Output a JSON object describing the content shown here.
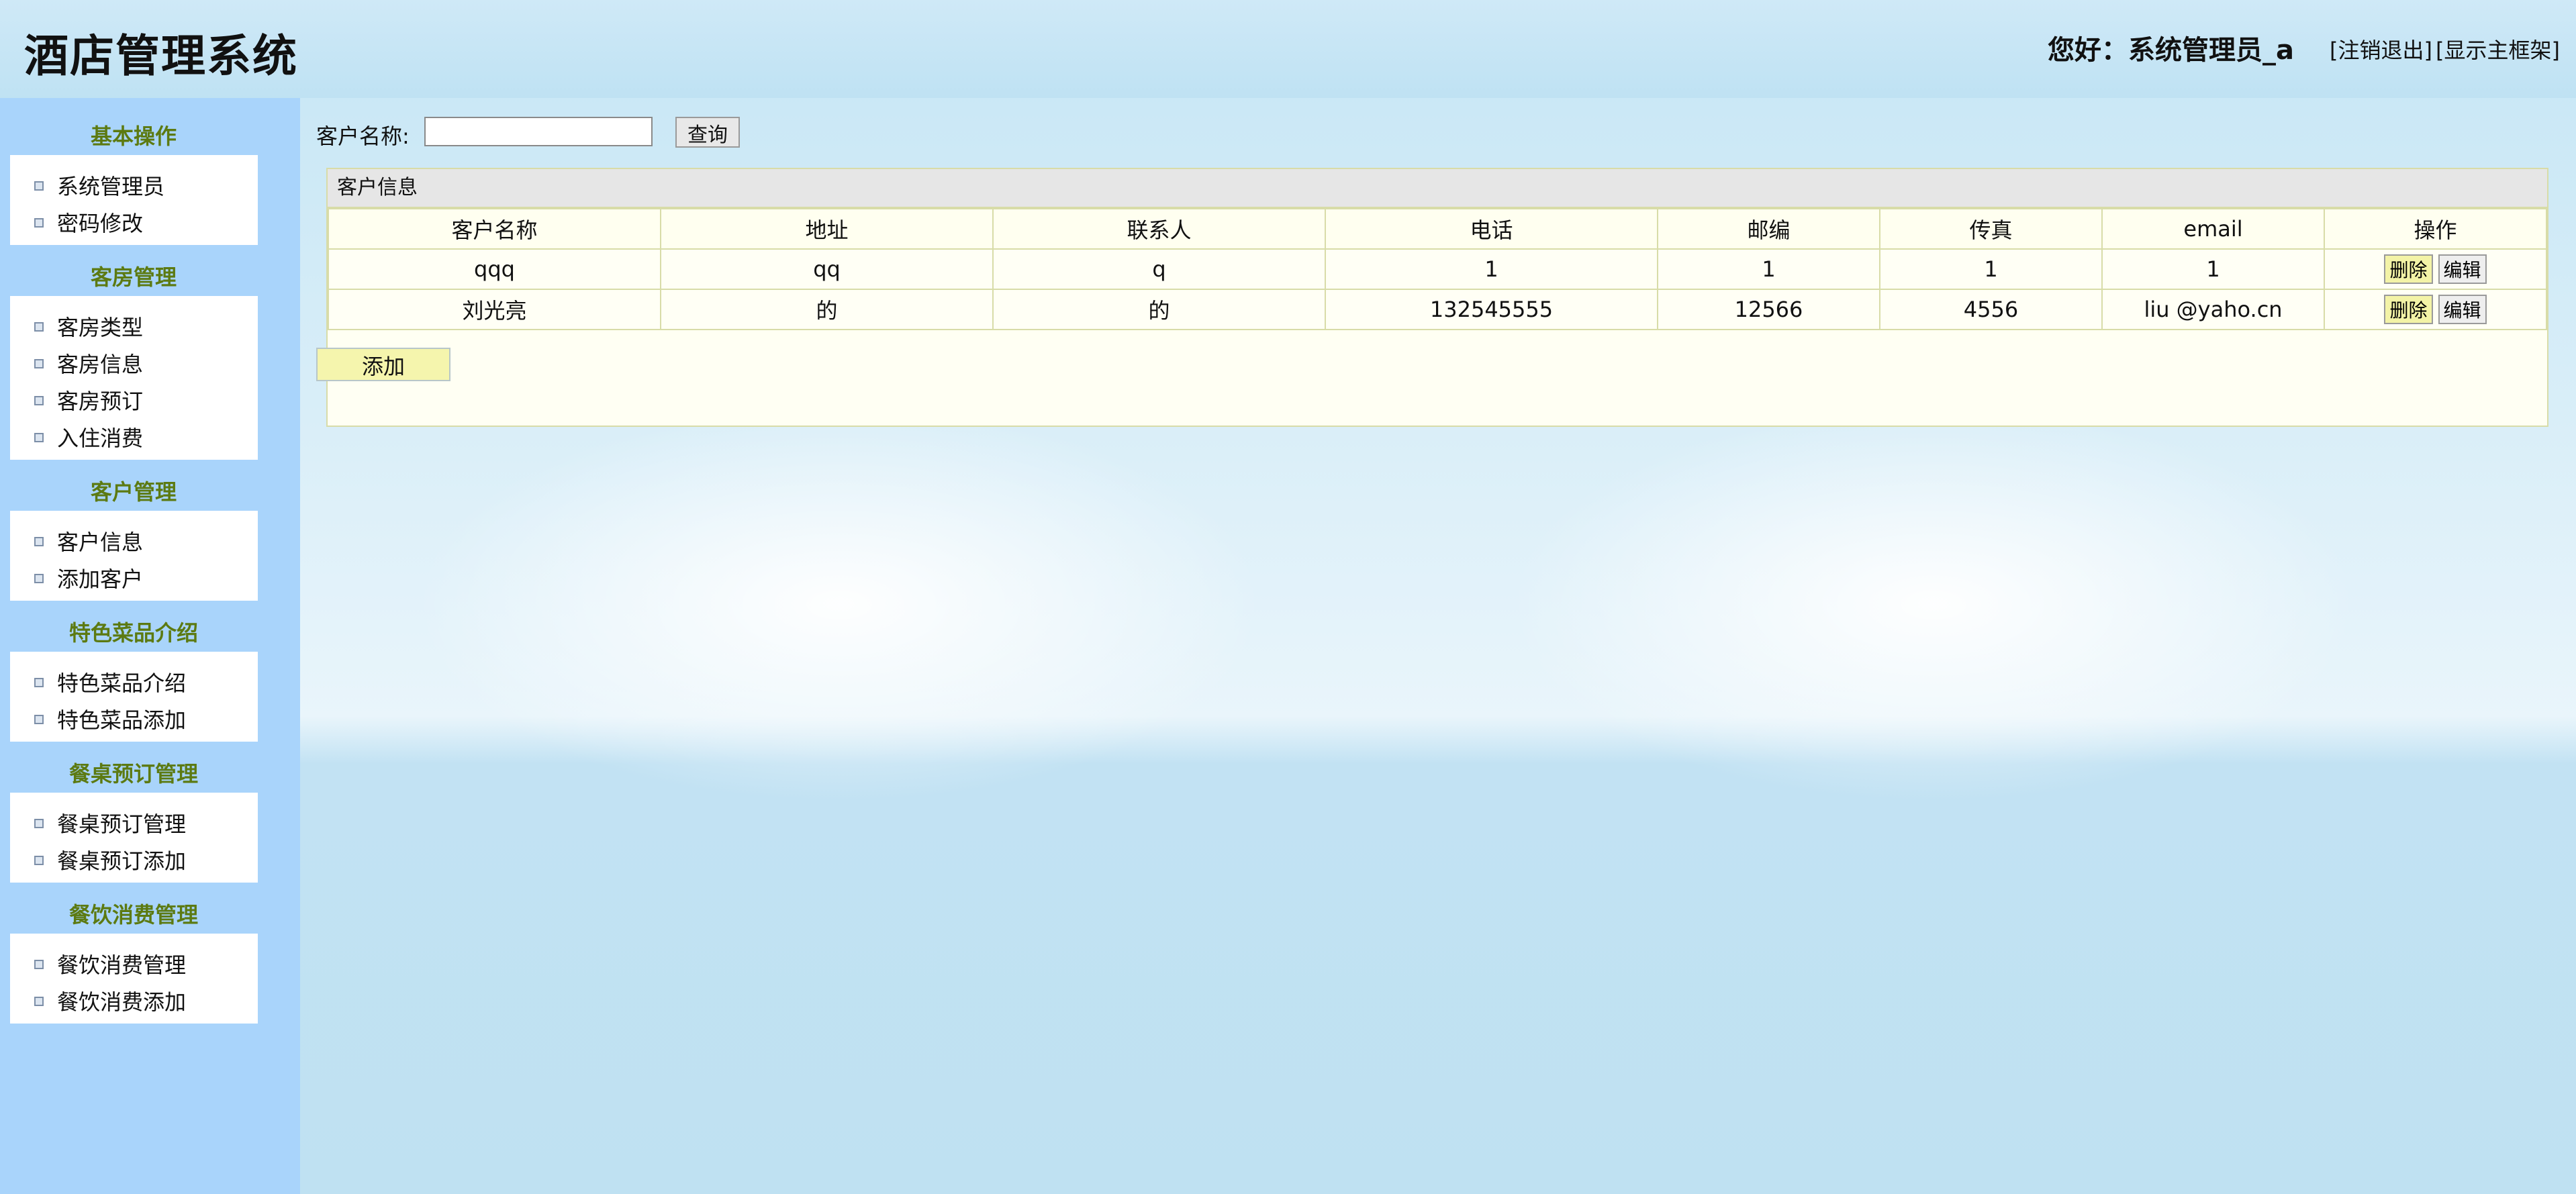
{
  "header": {
    "app_title": "酒店管理系统",
    "greeting": "您好：系统管理员_a",
    "logout_link": "[注销退出]",
    "show_frame_link": "[显示主框架]"
  },
  "sidebar": {
    "groups": [
      {
        "title": "基本操作",
        "items": [
          "系统管理员",
          "密码修改"
        ]
      },
      {
        "title": "客房管理",
        "items": [
          "客房类型",
          "客房信息",
          "客房预订",
          "入住消费"
        ]
      },
      {
        "title": "客户管理",
        "items": [
          "客户信息",
          "添加客户"
        ]
      },
      {
        "title": "特色菜品介绍",
        "items": [
          "特色菜品介绍",
          "特色菜品添加"
        ]
      },
      {
        "title": "餐桌预订管理",
        "items": [
          "餐桌预订管理",
          "餐桌预订添加"
        ]
      },
      {
        "title": "餐饮消费管理",
        "items": [
          "餐饮消费管理",
          "餐饮消费添加"
        ]
      }
    ]
  },
  "search": {
    "label": "客户名称:",
    "value": "",
    "button": "查询"
  },
  "panel": {
    "title": "客户信息",
    "columns": [
      "客户名称",
      "地址",
      "联系人",
      "电话",
      "邮编",
      "传真",
      "email",
      "操作"
    ],
    "rows": [
      [
        "qqq",
        "qq",
        "q",
        "1",
        "1",
        "1",
        "1"
      ],
      [
        "刘光亮",
        "的",
        "的",
        "132545555",
        "12566",
        "4556",
        "liu @yaho.cn"
      ]
    ],
    "delete_label": "删除",
    "edit_label": "编辑"
  },
  "add_button": "添加"
}
